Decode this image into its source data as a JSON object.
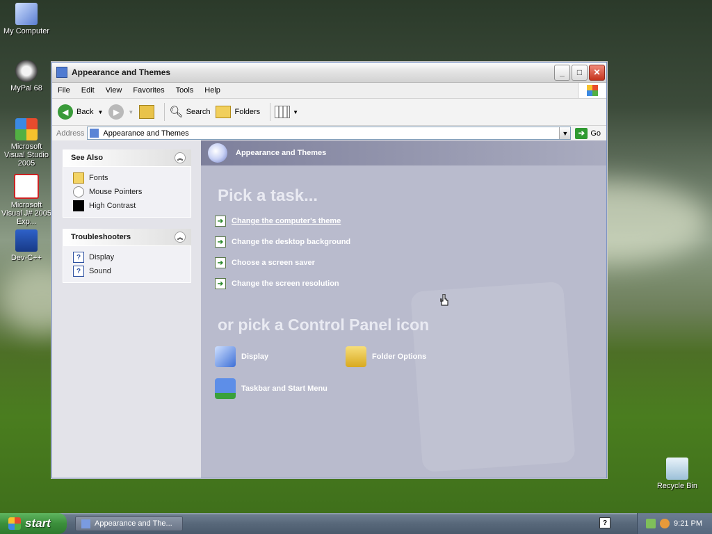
{
  "desktop": {
    "icons": [
      {
        "label": "My Computer",
        "icon": "computer-icon"
      },
      {
        "label": "MyPal 68",
        "icon": "raccoon-icon"
      },
      {
        "label": "Microsoft Visual Studio 2005",
        "icon": "visual-studio-icon"
      },
      {
        "label": "Microsoft Visual J# 2005 Exp...",
        "icon": "vj-icon"
      },
      {
        "label": "Dev-C++",
        "icon": "devcpp-icon"
      },
      {
        "label": "Recycle Bin",
        "icon": "recycle-bin-icon"
      }
    ]
  },
  "window": {
    "title": "Appearance and Themes",
    "menu": [
      "File",
      "Edit",
      "View",
      "Favorites",
      "Tools",
      "Help"
    ],
    "toolbar": {
      "back": "Back",
      "search": "Search",
      "folders": "Folders"
    },
    "address": {
      "label": "Address",
      "value": "Appearance and Themes",
      "go": "Go"
    },
    "see_also": {
      "title": "See Also",
      "items": [
        "Fonts",
        "Mouse Pointers",
        "High Contrast"
      ]
    },
    "troubleshooters": {
      "title": "Troubleshooters",
      "items": [
        "Display",
        "Sound"
      ]
    },
    "main": {
      "header": "Appearance and Themes",
      "pick_task": "Pick a task...",
      "tasks": [
        "Change the computer's theme",
        "Change the desktop background",
        "Choose a screen saver",
        "Change the screen resolution"
      ],
      "pick_icon": "or pick a Control Panel icon",
      "icons": [
        "Display",
        "Folder Options",
        "Taskbar and Start Menu"
      ]
    }
  },
  "taskbar": {
    "start": "start",
    "task": "Appearance and The...",
    "clock": "9:21 PM"
  },
  "colors": {
    "accent": "#2f9a31",
    "panel_bg": "#b9bbcd"
  }
}
